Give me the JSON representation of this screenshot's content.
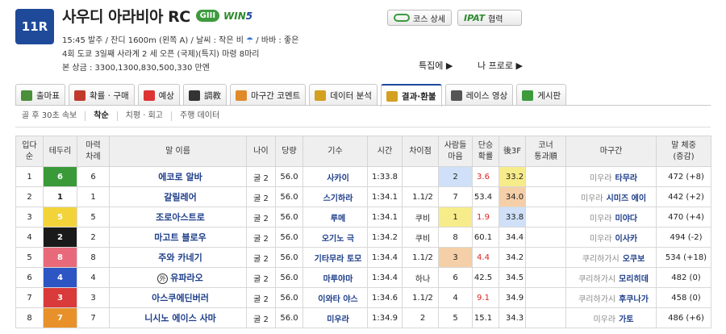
{
  "race": {
    "number": "11R",
    "title": "사우디 아라비아 RC",
    "grade": "GIII",
    "win5_a": "WIN",
    "win5_b": "5",
    "info1": "15:45 발주 / 잔디 1600m (왼쪽 A) / 날씨 : 작은 비",
    "info1b": "/ 바바 : 좋은",
    "info2": "4회 도쿄 3일째 사라계 2 세 오픈    (국제)(특지) 마령 8마리",
    "info3": "본 상금 : 3300,1300,830,500,330 만엔"
  },
  "buttons": {
    "course": "코스 상세",
    "ipat_logo": "IPAT",
    "ipat": "협력"
  },
  "links": {
    "feature": "특집에 ▶",
    "me": "나 프로로 ▶"
  },
  "tabs": [
    {
      "label": "출마표",
      "color": "#4a8f3a"
    },
    {
      "label": "확률 · 구매",
      "color": "#c0392b"
    },
    {
      "label": "예상",
      "color": "#d33"
    },
    {
      "label": "調教",
      "color": "#333"
    },
    {
      "label": "마구간 코멘트",
      "color": "#e08a2a"
    },
    {
      "label": "데이터 분석",
      "color": "#d4a020"
    },
    {
      "label": "결과·환불",
      "color": "#d4a020"
    },
    {
      "label": "레이스 영상",
      "color": "#555"
    },
    {
      "label": "게시판",
      "color": "#3d9a3d"
    }
  ],
  "subtabs": [
    "골 후 30초 속보",
    "착순",
    "치평 · 회고",
    "주행 데이터"
  ],
  "table": {
    "headers": [
      "입다\n순",
      "테두리",
      "마력\n차례",
      "말 이름",
      "나이",
      "당량",
      "기수",
      "시간",
      "차이점",
      "사람들\n마음",
      "단승\n확률",
      "後3F",
      "코너\n통과順",
      "마구간",
      "말 체중\n(증감)"
    ],
    "rows": [
      {
        "pos": "1",
        "gate": "6",
        "gate_bg": "#3a9a3a",
        "gate_fg": "#fff",
        "num": "6",
        "horse": "에코로 알바",
        "age": "굴 2",
        "wt": "56.0",
        "jockey": "사카이",
        "time": "1:33.8",
        "diff": "",
        "pop": "2",
        "pop_bg": "#cfe0f8",
        "odds": "3.6",
        "odds_red": true,
        "f3": "33.2",
        "f3_bg": "#f7ec8a",
        "corner": "",
        "region": "미우라",
        "trainer": "타무라",
        "body": "472 (+8)"
      },
      {
        "pos": "2",
        "gate": "1",
        "gate_bg": "#ffffff",
        "gate_fg": "#222",
        "num": "1",
        "horse": "갈릴레어",
        "age": "굴 2",
        "wt": "56.0",
        "jockey": "스기하라",
        "time": "1:34.1",
        "diff": "1.1/2",
        "pop": "7",
        "pop_bg": "",
        "odds": "53.4",
        "odds_red": false,
        "f3": "34.0",
        "f3_bg": "#f5cfa8",
        "corner": "",
        "region": "미우라",
        "trainer": "시미즈 에이",
        "body": "442 (+2)"
      },
      {
        "pos": "3",
        "gate": "5",
        "gate_bg": "#f2d43a",
        "gate_fg": "#fff",
        "num": "5",
        "horse": "조로아스트로",
        "age": "굴 2",
        "wt": "56.0",
        "jockey": "루메",
        "time": "1:34.1",
        "diff": "쿠비",
        "pop": "1",
        "pop_bg": "#f7ec8a",
        "odds": "1.9",
        "odds_red": true,
        "f3": "33.8",
        "f3_bg": "#cfe0f8",
        "corner": "",
        "region": "미우라",
        "trainer": "미야다",
        "body": "470 (+4)"
      },
      {
        "pos": "4",
        "gate": "2",
        "gate_bg": "#1a1a1a",
        "gate_fg": "#fff",
        "num": "2",
        "horse": "마고트 블로우",
        "age": "굴 2",
        "wt": "56.0",
        "jockey": "오기노 극",
        "time": "1:34.2",
        "diff": "쿠비",
        "pop": "8",
        "pop_bg": "",
        "odds": "60.1",
        "odds_red": false,
        "f3": "34.4",
        "f3_bg": "",
        "corner": "",
        "region": "미우라",
        "trainer": "이사카",
        "body": "494 (-2)"
      },
      {
        "pos": "5",
        "gate": "8",
        "gate_bg": "#e86a7a",
        "gate_fg": "#fff",
        "num": "8",
        "horse": "주와 카네기",
        "age": "굴 2",
        "wt": "56.0",
        "jockey": "기타무라 토모",
        "time": "1:34.4",
        "diff": "1.1/2",
        "pop": "3",
        "pop_bg": "#f5cfa8",
        "odds": "4.4",
        "odds_red": true,
        "f3": "34.2",
        "f3_bg": "",
        "corner": "",
        "region": "쿠리하가시",
        "trainer": "오쿠보",
        "body": "534 (+18)"
      },
      {
        "pos": "6",
        "gate": "4",
        "gate_bg": "#2d56c4",
        "gate_fg": "#fff",
        "num": "4",
        "horse": "유파라오",
        "foreign": "外",
        "age": "굴 2",
        "wt": "56.0",
        "jockey": "마루야마",
        "time": "1:34.4",
        "diff": "하나",
        "pop": "6",
        "pop_bg": "",
        "odds": "42.5",
        "odds_red": false,
        "f3": "34.5",
        "f3_bg": "",
        "corner": "",
        "region": "쿠리하가시",
        "trainer": "모리히데",
        "body": "482 (0)"
      },
      {
        "pos": "7",
        "gate": "3",
        "gate_bg": "#d93a3a",
        "gate_fg": "#fff",
        "num": "3",
        "horse": "아스쿠에딘버러",
        "age": "굴 2",
        "wt": "56.0",
        "jockey": "이와타 야스",
        "time": "1:34.6",
        "diff": "1.1/2",
        "pop": "4",
        "pop_bg": "",
        "odds": "9.1",
        "odds_red": true,
        "f3": "34.9",
        "f3_bg": "",
        "corner": "",
        "region": "쿠리하가시",
        "trainer": "후쿠나가",
        "body": "458 (0)"
      },
      {
        "pos": "8",
        "gate": "7",
        "gate_bg": "#e8912a",
        "gate_fg": "#fff",
        "num": "7",
        "horse": "니시노 에이스 사마",
        "age": "굴 2",
        "wt": "56.0",
        "jockey": "미우라",
        "time": "1:34.9",
        "diff": "2",
        "pop": "5",
        "pop_bg": "",
        "odds": "15.1",
        "odds_red": false,
        "f3": "34.3",
        "f3_bg": "",
        "corner": "",
        "region": "미우라",
        "trainer": "가토",
        "body": "486 (+6)"
      }
    ]
  }
}
